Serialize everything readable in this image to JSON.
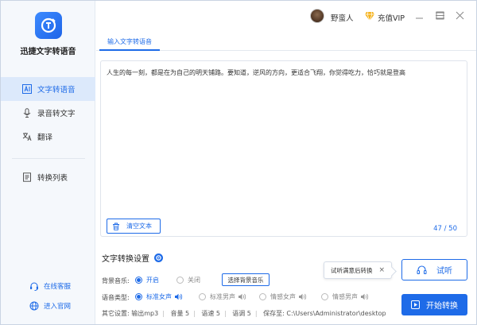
{
  "app": {
    "name": "迅捷文字转语音"
  },
  "sidebar": {
    "items": [
      {
        "label": "文字转语音",
        "icon": "text-to-speech-icon",
        "active": true
      },
      {
        "label": "录音转文字",
        "icon": "microphone-icon",
        "active": false
      },
      {
        "label": "翻译",
        "icon": "translate-icon",
        "active": false
      },
      {
        "label": "转换列表",
        "icon": "list-icon",
        "active": false
      }
    ],
    "footer": [
      {
        "label": "在线客服",
        "icon": "headset-icon"
      },
      {
        "label": "进入官网",
        "icon": "globe-icon"
      }
    ]
  },
  "header": {
    "username": "野蛮人",
    "vip_label": "充值VIP"
  },
  "tabs": [
    {
      "label": "输入文字转语音",
      "active": true
    }
  ],
  "editor": {
    "text": "人生的每一刻，都是在为自己的明天铺路。要知道，逆风的方向，更适合飞翔，你觉得吃力，恰巧就是登高",
    "clear_label": "清空文本",
    "char_count": "47 / 50"
  },
  "settings": {
    "title": "文字转换设置",
    "bgm": {
      "label": "背景音乐:",
      "on_label": "开启",
      "off_label": "关闭",
      "selected": "开启",
      "choose_button": "选择背景音乐"
    },
    "voice": {
      "label": "语音类型:",
      "options": [
        "标准女声",
        "标准男声",
        "情感女声",
        "情感男声"
      ],
      "selected": "标准女声"
    },
    "other": {
      "label": "其它设置:",
      "format": "输出mp3",
      "volume": "音量 5",
      "speed": "语速 5",
      "pitch": "语调 5",
      "save_to": "保存至: C:\\Users\\Administrator\\desktop"
    }
  },
  "actions": {
    "tooltip": "试听满意后转换",
    "tooltip_close": "×",
    "try_label": "试听",
    "start_label": "开始转换"
  },
  "colors": {
    "accent": "#1e6be8",
    "sidebar_bg": "#f5f8fc",
    "active_bg": "#dce9fb"
  }
}
